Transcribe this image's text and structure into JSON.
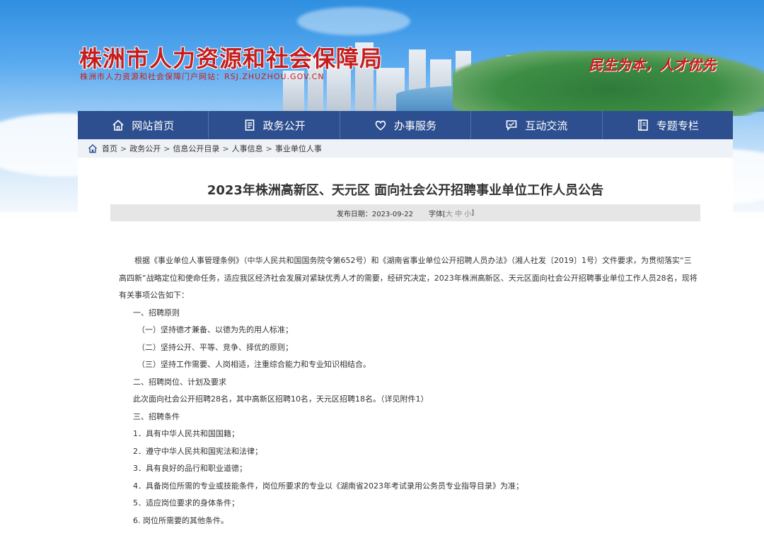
{
  "header": {
    "title": "株洲市人力资源和社会保障局",
    "subtitle": "株洲市人力资源和社会保障门户网站：RSJ.ZHUZHOU.GOV.CN",
    "slogan": "民生为本，人才优先"
  },
  "nav": [
    {
      "label": "网站首页",
      "icon": "home-icon"
    },
    {
      "label": "政务公开",
      "icon": "document-icon"
    },
    {
      "label": "办事服务",
      "icon": "heart-icon"
    },
    {
      "label": "互动交流",
      "icon": "chat-icon"
    },
    {
      "label": "专题专栏",
      "icon": "book-icon"
    }
  ],
  "breadcrumb": [
    "首页",
    "政务公开",
    "信息公开目录",
    "人事信息",
    "事业单位人事"
  ],
  "article": {
    "title": "2023年株洲高新区、天元区 面向社会公开招聘事业单位工作人员公告",
    "date_label": "发布日期：2023-09-22",
    "font_label": "字体[",
    "font_large": "大",
    "font_medium": "中",
    "font_small": "小",
    "font_end": "]",
    "paragraphs": [
      {
        "text": "根据《事业单位人事管理条例》（中华人民共和国国务院令第652号）和《湖南省事业单位公开招聘人员办法》（湘人社发〔2019〕1号）文件要求，为贯彻落实“三高四新”战略定位和使命任务，适应我区经济社会发展对紧缺优秀人才的需要，经研究决定，2023年株洲高新区、天元区面向社会公开招聘事业单位工作人员28名，现将有关事项公告如下：",
        "style": "indent"
      },
      {
        "text": "一、招聘原则",
        "style": "ind1"
      },
      {
        "text": "（一）坚持德才兼备、以德为先的用人标准；",
        "style": "ind1"
      },
      {
        "text": "（二）坚持公开、平等、竞争、择优的原则；",
        "style": "ind1"
      },
      {
        "text": "（三）坚持工作需要、人岗相适，注重综合能力和专业知识相结合。",
        "style": "ind1"
      },
      {
        "text": "二、招聘岗位、计划及要求",
        "style": "ind1"
      },
      {
        "text": "此次面向社会公开招聘28名，其中高新区招聘10名，天元区招聘18名。（详见附件1）",
        "style": "ind1"
      },
      {
        "text": "三、招聘条件",
        "style": "ind1"
      },
      {
        "text": "1．具有中华人民共和国国籍；",
        "style": "ind1"
      },
      {
        "text": "2．遵守中华人民共和国宪法和法律；",
        "style": "ind1"
      },
      {
        "text": "3．具有良好的品行和职业道德；",
        "style": "ind1"
      },
      {
        "text": "4．具备岗位所需的专业或技能条件，岗位所要求的专业以《湖南省2023年考试录用公务员专业指导目录》为准；",
        "style": "ind1"
      },
      {
        "text": "5．适应岗位要求的身体条件；",
        "style": "ind1"
      },
      {
        "text": "6. 岗位所需要的其他条件。",
        "style": "ind1"
      }
    ]
  },
  "colors": {
    "nav_bg": "#2d4f8f",
    "title_red": "#c41e1e",
    "meta_bg": "#e6e6e6"
  }
}
